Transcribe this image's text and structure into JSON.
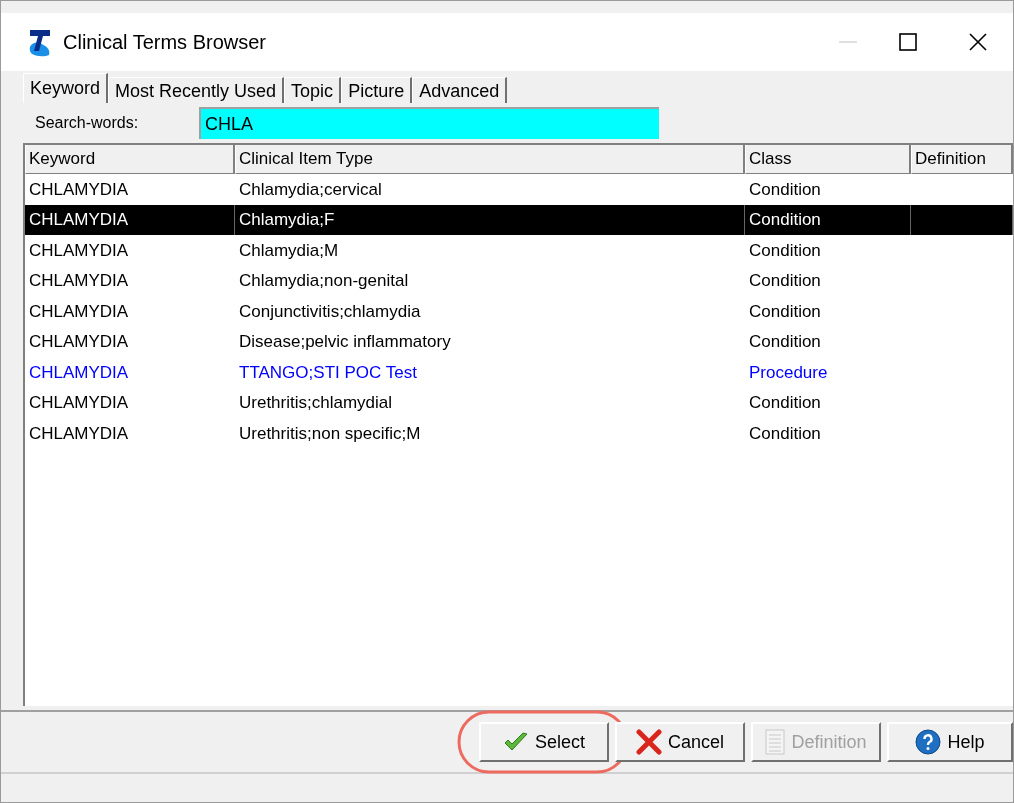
{
  "window": {
    "title": "Clinical Terms Browser"
  },
  "tabs": [
    {
      "label": "Keyword",
      "selected": true
    },
    {
      "label": "Most Recently Used",
      "selected": false
    },
    {
      "label": "Topic",
      "selected": false
    },
    {
      "label": "Picture",
      "selected": false
    },
    {
      "label": "Advanced",
      "selected": false
    }
  ],
  "search": {
    "label": "Search-words:",
    "value": "CHLA"
  },
  "table": {
    "columns": [
      "Keyword",
      "Clinical Item Type",
      "Class",
      "Definition"
    ],
    "rows": [
      {
        "cells": [
          "CHLAMYDIA",
          "Chlamydia;cervical",
          "Condition"
        ],
        "selected": false,
        "color": "#000000"
      },
      {
        "cells": [
          "CHLAMYDIA",
          "Chlamydia;F",
          "Condition"
        ],
        "selected": true,
        "color": "#000000"
      },
      {
        "cells": [
          "CHLAMYDIA",
          "Chlamydia;M",
          "Condition"
        ],
        "selected": false,
        "color": "#000000"
      },
      {
        "cells": [
          "CHLAMYDIA",
          "Chlamydia;non-genital",
          "Condition"
        ],
        "selected": false,
        "color": "#000000"
      },
      {
        "cells": [
          "CHLAMYDIA",
          "Conjunctivitis;chlamydia",
          "Condition"
        ],
        "selected": false,
        "color": "#000000"
      },
      {
        "cells": [
          "CHLAMYDIA",
          "Disease;pelvic inflammatory",
          "Condition"
        ],
        "selected": false,
        "color": "#000000"
      },
      {
        "cells": [
          "CHLAMYDIA",
          "TTANGO;STI POC Test",
          "Procedure"
        ],
        "selected": false,
        "color": "#0000ff"
      },
      {
        "cells": [
          "CHLAMYDIA",
          "Urethritis;chlamydial",
          "Condition"
        ],
        "selected": false,
        "color": "#000000"
      },
      {
        "cells": [
          "CHLAMYDIA",
          "Urethritis;non specific;M",
          "Condition"
        ],
        "selected": false,
        "color": "#000000"
      }
    ]
  },
  "buttons": [
    {
      "label": "Select",
      "kind": "check",
      "disabled": false,
      "highlighted": true
    },
    {
      "label": "Cancel",
      "kind": "cross",
      "disabled": false,
      "highlighted": false
    },
    {
      "label": "Definition",
      "kind": "document",
      "disabled": true,
      "highlighted": false
    },
    {
      "label": "Help",
      "kind": "help",
      "disabled": false,
      "highlighted": false
    }
  ]
}
